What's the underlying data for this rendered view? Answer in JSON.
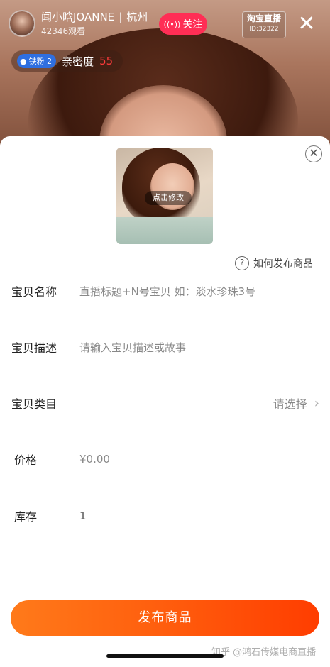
{
  "live": {
    "anchor_name": "闻小晗JOANNE",
    "anchor_city": "杭州",
    "viewers": "42346观看",
    "follow_label": "关注",
    "follow_icon": "live-signal-icon",
    "platform_badge_title": "淘宝直播",
    "platform_badge_id": "ID:32322",
    "close_icon": "close-icon",
    "fan_badge_label": "铁粉 2",
    "intimacy_label": "亲密度",
    "intimacy_value": "55",
    "colors": {
      "follow": "#ff2e55",
      "fan_badge": "#2f6fe0",
      "intimacy": "#ff3b3b"
    }
  },
  "sheet": {
    "close_icon": "close-circle-icon",
    "cover_edit_label": "点击修改",
    "howto_label": "如何发布商品",
    "howto_icon": "question-circle-icon",
    "fields": {
      "name": {
        "label": "宝贝名称",
        "placeholder": "直播标题+N号宝贝 如：淡水珍珠3号"
      },
      "description": {
        "label": "宝贝描述",
        "placeholder": "请输入宝贝描述或故事"
      },
      "category": {
        "label": "宝贝类目",
        "select_label": "请选择",
        "icon": "chevron-right-icon"
      },
      "price": {
        "label": "价格",
        "value": "¥0.00"
      },
      "stock": {
        "label": "库存",
        "value": "1"
      }
    },
    "publish_label": "发布商品",
    "publish_colors": [
      "#ff7a1a",
      "#ff3d00"
    ]
  },
  "watermark": "知乎 @鸿石传媒电商直播"
}
